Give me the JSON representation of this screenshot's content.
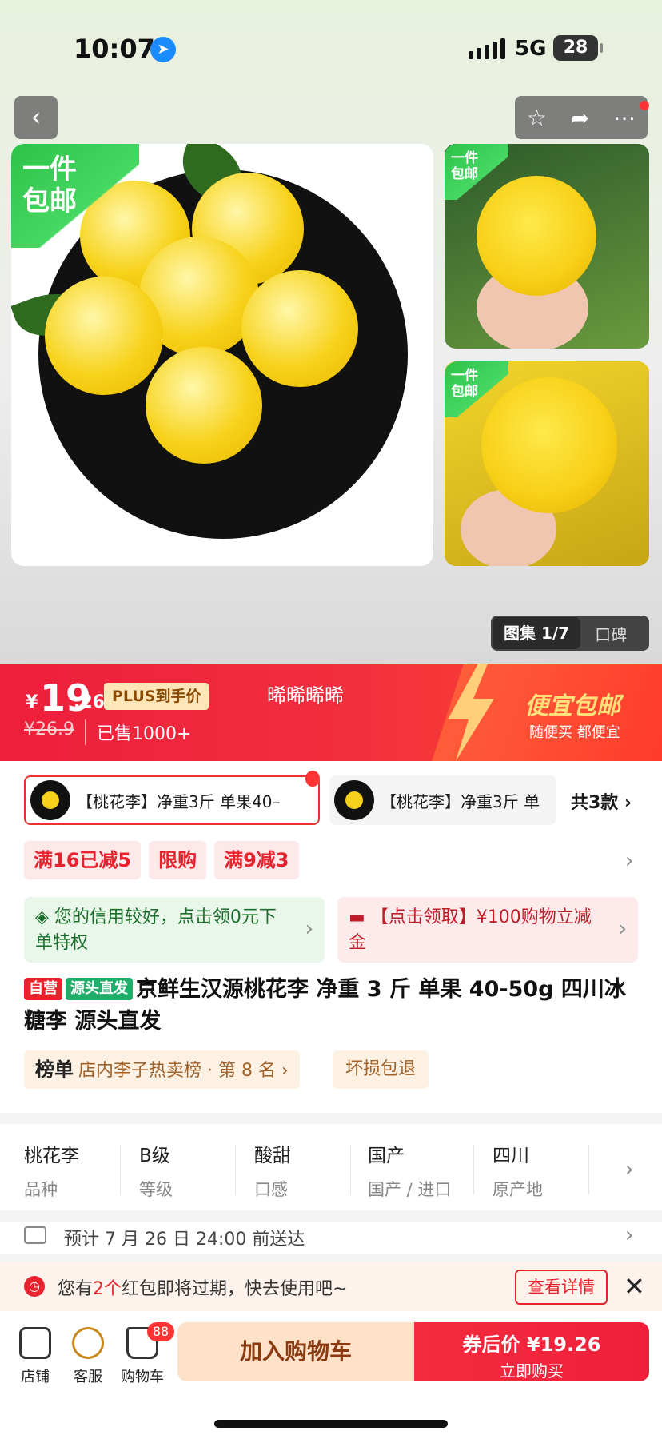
{
  "status": {
    "time": "10:07",
    "network": "5G",
    "battery": "28"
  },
  "nav": {
    "back_icon": "chevron-left-icon",
    "favorite_icon": "star-icon",
    "share_icon": "share-icon",
    "more_icon": "more-icon"
  },
  "gallery": {
    "badge_main": "一件\n包邮",
    "badge_thumb1": "一件\n包邮",
    "badge_thumb2": "一件\n包邮",
    "album_label": "图集 1/7",
    "review_label": "口碑"
  },
  "price_banner": {
    "currency": "¥",
    "price_int": "19",
    "price_dec": ".26",
    "plus_label": "PLUS到手价",
    "original_price": "¥26.9",
    "sold": "已售1000+",
    "center_text": "晞晞晞晞",
    "promo_title": "便宜包邮",
    "promo_sub": "随便买 都便宜"
  },
  "sku": {
    "item1": "【桃花李】净重3斤 单果40–",
    "item2": "【桃花李】净重3斤 单",
    "more": "共3款"
  },
  "tags": [
    "满16已减5",
    "限购",
    "满9减3"
  ],
  "coupons": {
    "green": "您的信用较好，点击领0元下单特权",
    "pink": "【点击领取】¥100购物立减金"
  },
  "title": {
    "tag_self": "自营",
    "tag_source": "源头直发",
    "text": "京鲜生汉源桃花李 净重 3 斤 单果 40-50g 四川冰糖李 源头直发"
  },
  "rank": {
    "label": "榜单",
    "text": "店内李子热卖榜 · 第 8 名 ›",
    "guarantee": "坏损包退"
  },
  "specs": [
    {
      "value": "桃花李",
      "key": "品种"
    },
    {
      "value": "B级",
      "key": "等级"
    },
    {
      "value": "酸甜",
      "key": "口感"
    },
    {
      "value": "国产",
      "key": "国产 / 进口"
    },
    {
      "value": "四川",
      "key": "原产地"
    }
  ],
  "delivery": {
    "text": "预计 7 月 26 日 24:00 前送达"
  },
  "redpack": {
    "prefix": "您有",
    "count": "2个",
    "suffix": "红包即将过期，快去使用吧~",
    "button": "查看详情"
  },
  "bottom": {
    "store": "店铺",
    "service": "客服",
    "cart": "购物车",
    "cart_count": "88",
    "add_cart": "加入购物车",
    "buy_line1": "券后价 ¥19.26",
    "buy_line2": "立即购买"
  }
}
